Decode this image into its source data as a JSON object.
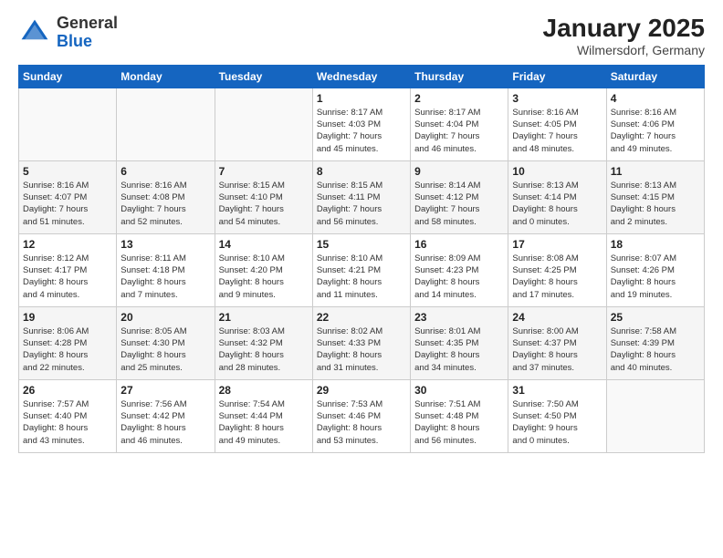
{
  "logo": {
    "general": "General",
    "blue": "Blue"
  },
  "header": {
    "title": "January 2025",
    "subtitle": "Wilmersdorf, Germany"
  },
  "days_of_week": [
    "Sunday",
    "Monday",
    "Tuesday",
    "Wednesday",
    "Thursday",
    "Friday",
    "Saturday"
  ],
  "weeks": [
    [
      {
        "day": "",
        "info": ""
      },
      {
        "day": "",
        "info": ""
      },
      {
        "day": "",
        "info": ""
      },
      {
        "day": "1",
        "info": "Sunrise: 8:17 AM\nSunset: 4:03 PM\nDaylight: 7 hours\nand 45 minutes."
      },
      {
        "day": "2",
        "info": "Sunrise: 8:17 AM\nSunset: 4:04 PM\nDaylight: 7 hours\nand 46 minutes."
      },
      {
        "day": "3",
        "info": "Sunrise: 8:16 AM\nSunset: 4:05 PM\nDaylight: 7 hours\nand 48 minutes."
      },
      {
        "day": "4",
        "info": "Sunrise: 8:16 AM\nSunset: 4:06 PM\nDaylight: 7 hours\nand 49 minutes."
      }
    ],
    [
      {
        "day": "5",
        "info": "Sunrise: 8:16 AM\nSunset: 4:07 PM\nDaylight: 7 hours\nand 51 minutes."
      },
      {
        "day": "6",
        "info": "Sunrise: 8:16 AM\nSunset: 4:08 PM\nDaylight: 7 hours\nand 52 minutes."
      },
      {
        "day": "7",
        "info": "Sunrise: 8:15 AM\nSunset: 4:10 PM\nDaylight: 7 hours\nand 54 minutes."
      },
      {
        "day": "8",
        "info": "Sunrise: 8:15 AM\nSunset: 4:11 PM\nDaylight: 7 hours\nand 56 minutes."
      },
      {
        "day": "9",
        "info": "Sunrise: 8:14 AM\nSunset: 4:12 PM\nDaylight: 7 hours\nand 58 minutes."
      },
      {
        "day": "10",
        "info": "Sunrise: 8:13 AM\nSunset: 4:14 PM\nDaylight: 8 hours\nand 0 minutes."
      },
      {
        "day": "11",
        "info": "Sunrise: 8:13 AM\nSunset: 4:15 PM\nDaylight: 8 hours\nand 2 minutes."
      }
    ],
    [
      {
        "day": "12",
        "info": "Sunrise: 8:12 AM\nSunset: 4:17 PM\nDaylight: 8 hours\nand 4 minutes."
      },
      {
        "day": "13",
        "info": "Sunrise: 8:11 AM\nSunset: 4:18 PM\nDaylight: 8 hours\nand 7 minutes."
      },
      {
        "day": "14",
        "info": "Sunrise: 8:10 AM\nSunset: 4:20 PM\nDaylight: 8 hours\nand 9 minutes."
      },
      {
        "day": "15",
        "info": "Sunrise: 8:10 AM\nSunset: 4:21 PM\nDaylight: 8 hours\nand 11 minutes."
      },
      {
        "day": "16",
        "info": "Sunrise: 8:09 AM\nSunset: 4:23 PM\nDaylight: 8 hours\nand 14 minutes."
      },
      {
        "day": "17",
        "info": "Sunrise: 8:08 AM\nSunset: 4:25 PM\nDaylight: 8 hours\nand 17 minutes."
      },
      {
        "day": "18",
        "info": "Sunrise: 8:07 AM\nSunset: 4:26 PM\nDaylight: 8 hours\nand 19 minutes."
      }
    ],
    [
      {
        "day": "19",
        "info": "Sunrise: 8:06 AM\nSunset: 4:28 PM\nDaylight: 8 hours\nand 22 minutes."
      },
      {
        "day": "20",
        "info": "Sunrise: 8:05 AM\nSunset: 4:30 PM\nDaylight: 8 hours\nand 25 minutes."
      },
      {
        "day": "21",
        "info": "Sunrise: 8:03 AM\nSunset: 4:32 PM\nDaylight: 8 hours\nand 28 minutes."
      },
      {
        "day": "22",
        "info": "Sunrise: 8:02 AM\nSunset: 4:33 PM\nDaylight: 8 hours\nand 31 minutes."
      },
      {
        "day": "23",
        "info": "Sunrise: 8:01 AM\nSunset: 4:35 PM\nDaylight: 8 hours\nand 34 minutes."
      },
      {
        "day": "24",
        "info": "Sunrise: 8:00 AM\nSunset: 4:37 PM\nDaylight: 8 hours\nand 37 minutes."
      },
      {
        "day": "25",
        "info": "Sunrise: 7:58 AM\nSunset: 4:39 PM\nDaylight: 8 hours\nand 40 minutes."
      }
    ],
    [
      {
        "day": "26",
        "info": "Sunrise: 7:57 AM\nSunset: 4:40 PM\nDaylight: 8 hours\nand 43 minutes."
      },
      {
        "day": "27",
        "info": "Sunrise: 7:56 AM\nSunset: 4:42 PM\nDaylight: 8 hours\nand 46 minutes."
      },
      {
        "day": "28",
        "info": "Sunrise: 7:54 AM\nSunset: 4:44 PM\nDaylight: 8 hours\nand 49 minutes."
      },
      {
        "day": "29",
        "info": "Sunrise: 7:53 AM\nSunset: 4:46 PM\nDaylight: 8 hours\nand 53 minutes."
      },
      {
        "day": "30",
        "info": "Sunrise: 7:51 AM\nSunset: 4:48 PM\nDaylight: 8 hours\nand 56 minutes."
      },
      {
        "day": "31",
        "info": "Sunrise: 7:50 AM\nSunset: 4:50 PM\nDaylight: 9 hours\nand 0 minutes."
      },
      {
        "day": "",
        "info": ""
      }
    ]
  ]
}
